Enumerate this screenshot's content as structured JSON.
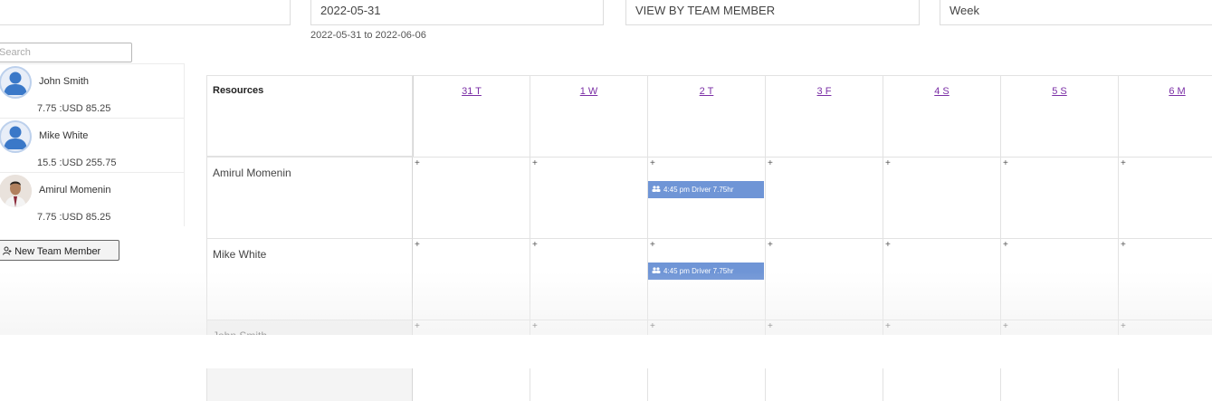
{
  "toolbar": {
    "box0": "",
    "date": "2022-05-31",
    "view": "VIEW BY TEAM MEMBER",
    "period": "Week",
    "range": "2022-05-31 to 2022-06-06"
  },
  "sidebar": {
    "search_placeholder": "Search",
    "members": [
      {
        "name": "John Smith",
        "rate": "7.75 :USD 85.25",
        "avatar": "generic"
      },
      {
        "name": "Mike White",
        "rate": "15.5 :USD 255.75",
        "avatar": "generic"
      },
      {
        "name": "Amirul Momenin",
        "rate": "7.75 :USD 85.25",
        "avatar": "photo"
      }
    ],
    "new_member_label": "New Team Member"
  },
  "schedule": {
    "resources_header": "Resources",
    "days": [
      "31 T",
      "1 W",
      "2 T",
      "3 F",
      "4 S",
      "5 S",
      "6 M"
    ],
    "rows": [
      {
        "name": "Amirul Momenin",
        "events": [
          {
            "day": 2,
            "text": "4:45 pm Driver 7.75hr"
          }
        ]
      },
      {
        "name": "Mike White",
        "events": [
          {
            "day": 2,
            "text": "4:45 pm Driver 7.75hr"
          }
        ]
      },
      {
        "name": "John Smith",
        "events": []
      }
    ],
    "add_symbol": "+"
  },
  "colors": {
    "event_bg": "#6f95d6",
    "day_link": "#7b2fa6",
    "avatar_blue": "#3a78c8"
  },
  "icons": {
    "generic_avatar": "person-icon",
    "new_member": "add-user-icon",
    "event": "people-icon"
  }
}
